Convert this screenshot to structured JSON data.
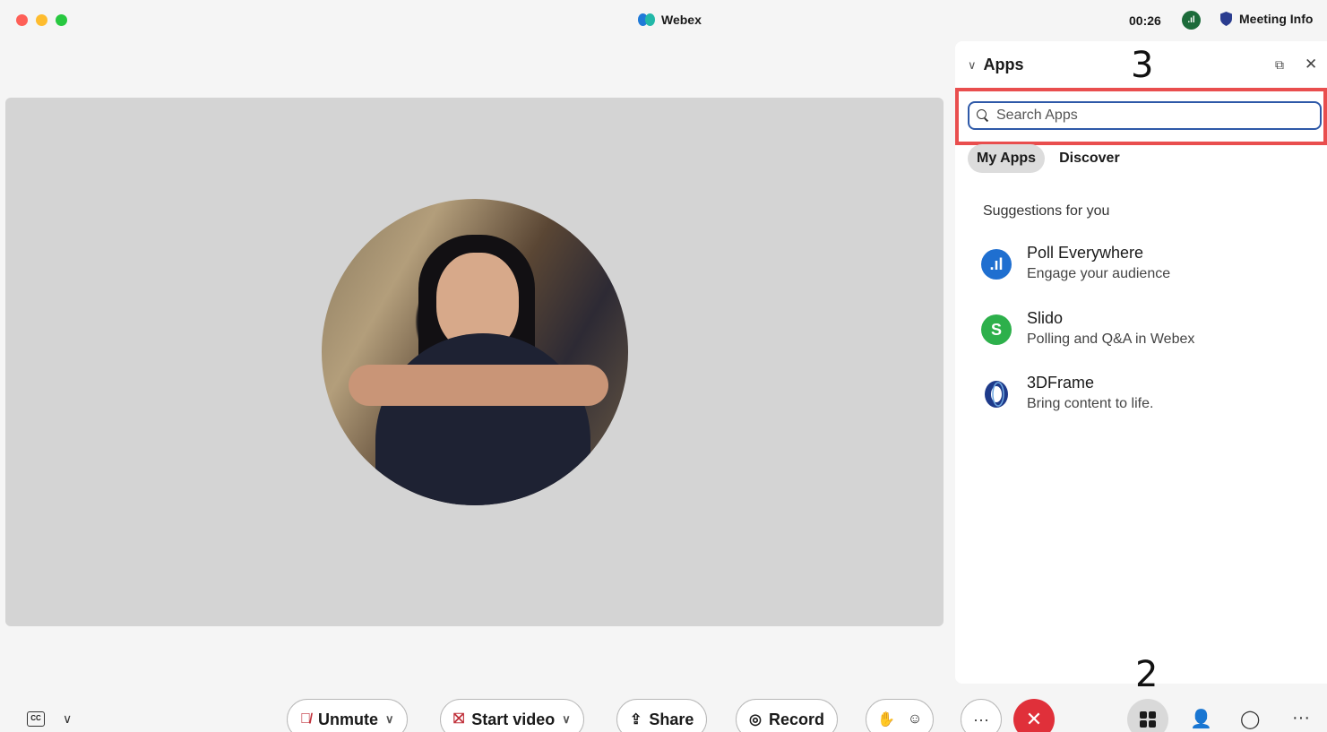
{
  "window": {
    "app_title": "Webex",
    "timer": "00:26",
    "meeting_info_label": "Meeting Info",
    "signal_icon": "signal-strength-icon"
  },
  "apps_panel": {
    "title": "Apps",
    "search": {
      "placeholder": "Search Apps",
      "value": ""
    },
    "tabs": [
      {
        "label": "My Apps",
        "active": true
      },
      {
        "label": "Discover",
        "active": false
      }
    ],
    "section_title": "Suggestions for you",
    "suggestions": [
      {
        "name": "Poll Everywhere",
        "description": "Engage your audience",
        "icon": "poll-everywhere-icon",
        "color": "#1f6fd0"
      },
      {
        "name": "Slido",
        "description": "Polling and Q&A in Webex",
        "icon": "slido-icon",
        "color": "#2db04b"
      },
      {
        "name": "3DFrame",
        "description": "Bring content to life.",
        "icon": "3dframe-icon",
        "color": "#1e3a8a"
      }
    ]
  },
  "annotations": {
    "step_3": "3",
    "step_2": "2",
    "highlight_color": "#e94e4e"
  },
  "toolbar": {
    "unmute_label": "Unmute",
    "start_video_label": "Start video",
    "share_label": "Share",
    "record_label": "Record",
    "end_call_color": "#e0303a"
  }
}
